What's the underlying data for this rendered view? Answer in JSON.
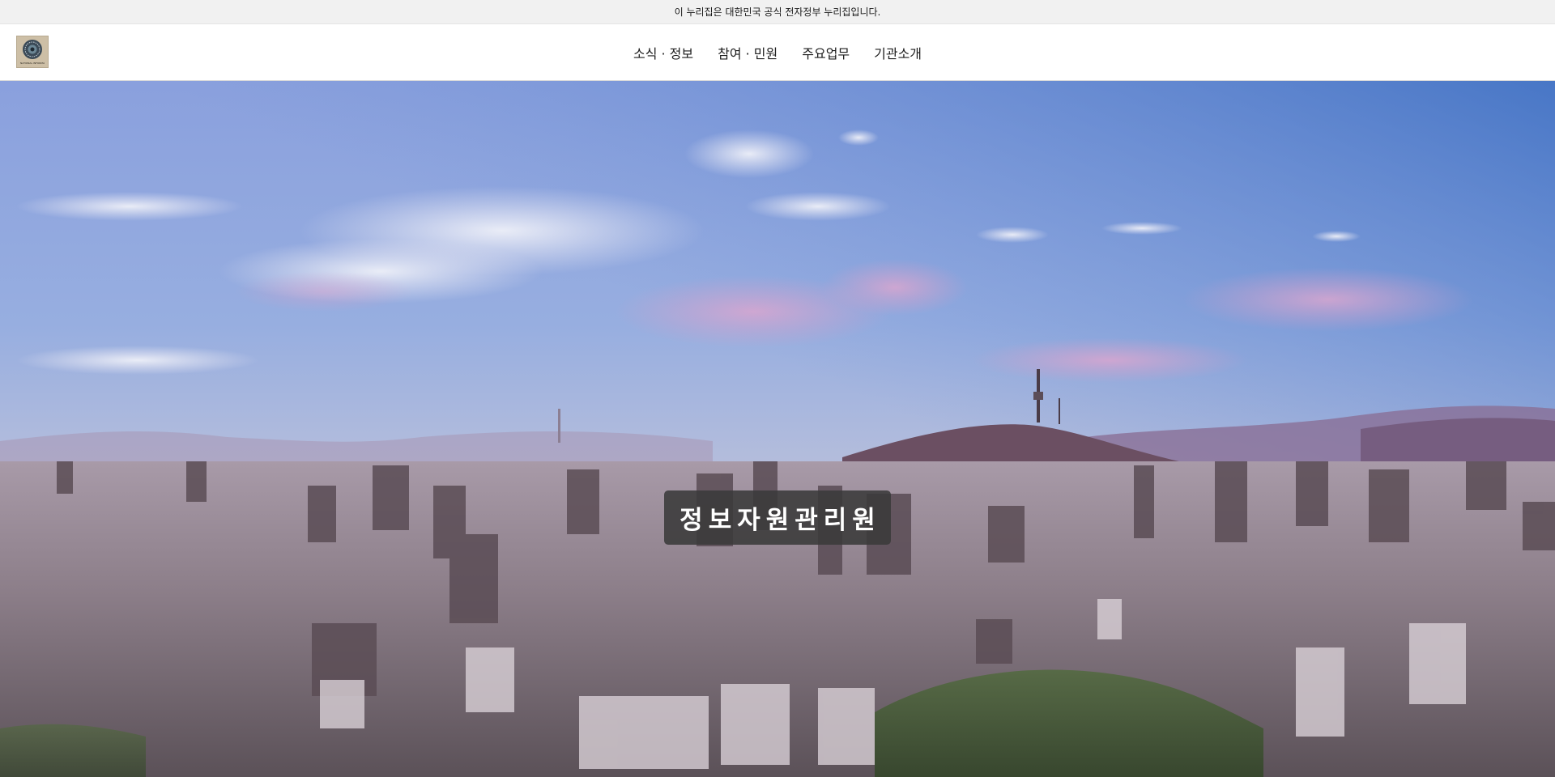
{
  "gov_banner": {
    "text": "이 누리집은 대한민국 공식 전자정부 누리집입니다."
  },
  "header": {
    "logo_icon": "agency-emblem-icon",
    "logo_text": "NATIONAL INFORMATION RESOURCES SERVICE",
    "nav": [
      {
        "label": "소식 · 정보"
      },
      {
        "label": "참여 · 민원"
      },
      {
        "label": "주요업무"
      },
      {
        "label": "기관소개"
      }
    ]
  },
  "hero": {
    "title": "정보자원관리원",
    "image": "seoul-city-skyline-at-dusk",
    "colors": {
      "sky_top": "#8ea6df",
      "sky_horizon": "#d8c4cf",
      "title_background": "#3a3a3a",
      "title_text": "#ffffff"
    }
  }
}
